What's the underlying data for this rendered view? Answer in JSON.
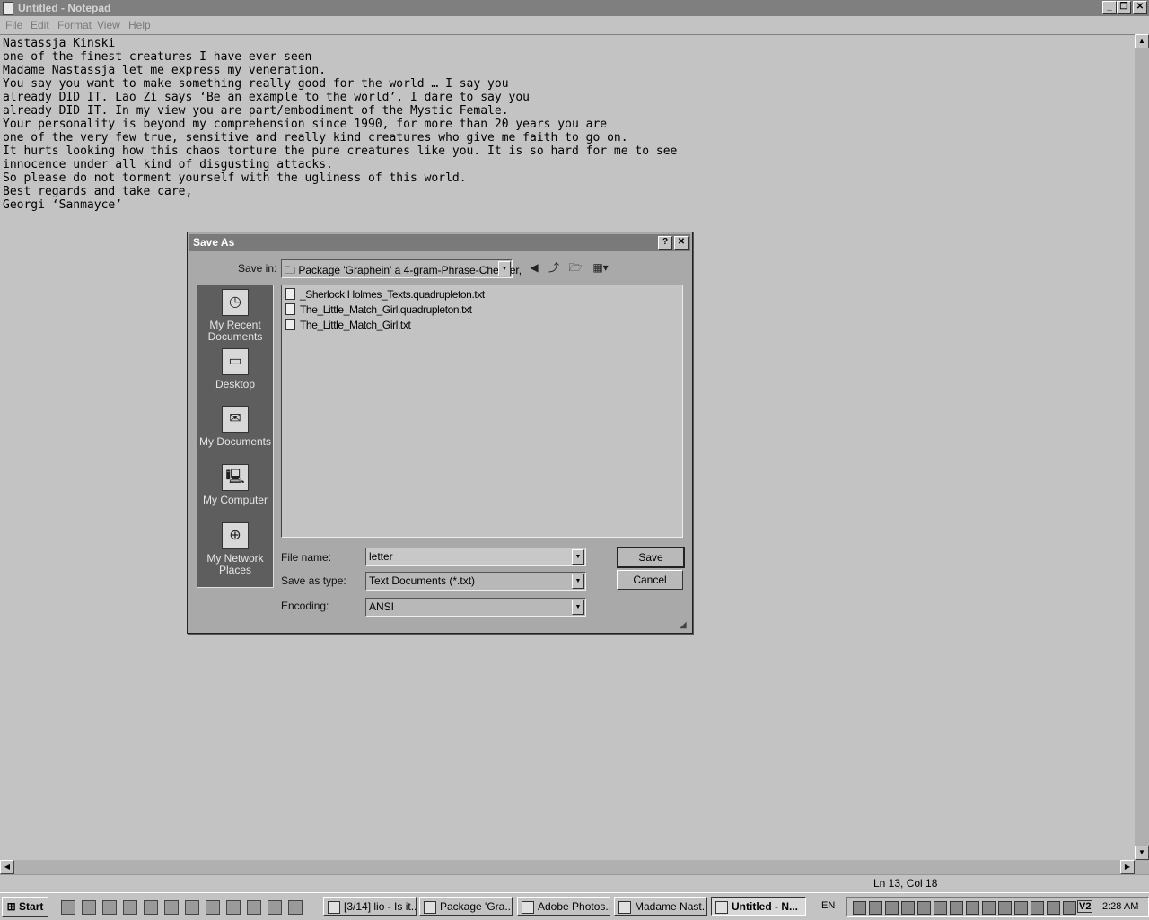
{
  "window": {
    "title": "Untitled - Notepad",
    "controls": {
      "minimize": "_",
      "maximize": "❐",
      "close": "✕"
    }
  },
  "menu": [
    "File",
    "Edit",
    "Format",
    "View",
    "Help"
  ],
  "editor": {
    "text": "Nastassja Kinski\none of the finest creatures I have ever seen\nMadame Nastassja let me express my veneration.\nYou say you want to make something really good for the world … I say you\nalready DID IT. Lao Zi says ‘Be an example to the world’, I dare to say you\nalready DID IT. In my view you are part/embodiment of the Mystic Female.\nYour personality is beyond my comprehension since 1990, for more than 20 years you are\none of the very few true, sensitive and really kind creatures who give me faith to go on.\nIt hurts looking how this chaos torture the pure creatures like you. It is so hard for me to see\ninnocence under all kind of disgusting attacks.\nSo please do not torment yourself with the ugliness of this world.\nBest regards and take care,\nGeorgi ‘Sanmayce’"
  },
  "status": {
    "position": "Ln 13, Col 18"
  },
  "dialog": {
    "title": "Save As",
    "help_btn": "?",
    "close_btn": "✕",
    "save_in_label": "Save in:",
    "save_in_value": "Package 'Graphein' a 4-gram-Phrase-Checker, ",
    "places": [
      "My Recent\nDocuments",
      "Desktop",
      "My Documents",
      "My Computer",
      "My Network\nPlaces"
    ],
    "files": [
      "_Sherlock Holmes_Texts.quadrupleton.txt",
      "The_Little_Match_Girl.quadrupleton.txt",
      "The_Little_Match_Girl.txt"
    ],
    "file_name_label": "File name:",
    "file_name_value": "letter",
    "save_as_type_label": "Save as type:",
    "save_as_type_value": "Text Documents (*.txt)",
    "encoding_label": "Encoding:",
    "encoding_value": "ANSI",
    "save_button": "Save",
    "cancel_button": "Cancel"
  },
  "taskbar": {
    "start": "Start",
    "tasks": [
      "[3/14] lio - Is it...",
      "Package 'Gra...",
      "Adobe Photos...",
      "Madame Nast...",
      "Untitled - N..."
    ],
    "lang": "EN",
    "clock": "2:28 AM",
    "tray_label": "V2"
  }
}
